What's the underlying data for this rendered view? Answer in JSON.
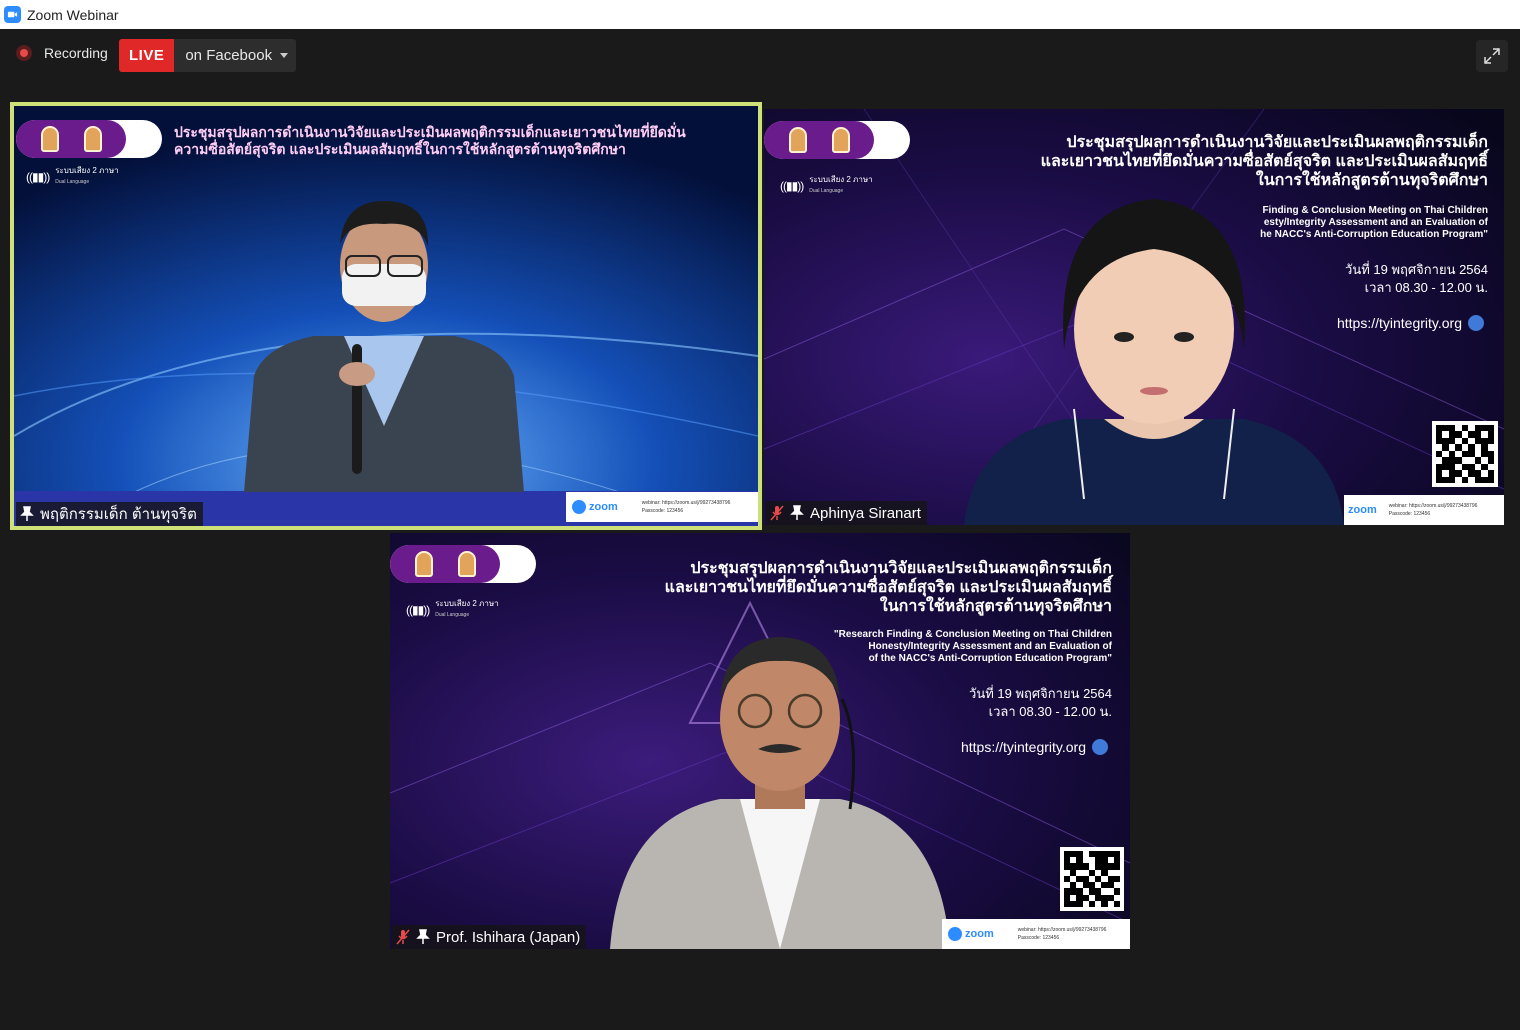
{
  "window": {
    "title": "Zoom Webinar"
  },
  "toolbar": {
    "recording_label": "Recording",
    "live_badge": "LIVE",
    "live_target": "on Facebook"
  },
  "tiles": [
    {
      "name": "พฤติกรรมเด็ก ต้านทุจริต",
      "muted": false,
      "active_speaker": true,
      "heading_th": [
        "ประชุมสรุปผลการดำเนินงานวิจัยและประเมินผลพฤติกรรมเด็กและเยาวชนไทยที่ยึดมั่น",
        "ความซื่อสัตย์สุจริต และประเมินผลสัมฤทธิ์ในการใช้หลักสูตรต้านทุจริตศึกษา"
      ],
      "dual_language": "ระบบเสียง 2 ภาษา",
      "dual_language_en": "Dual Language",
      "zoom_text": "zoom",
      "zoom_info": [
        "webinar: https://zoom.us/j/99273438796",
        "Passcode: 123456"
      ]
    },
    {
      "name": "Aphinya Siranart",
      "muted": true,
      "active_speaker": false,
      "heading_th": [
        "ประชุมสรุปผลการดำเนินงานวิจัยและประเมินผลพฤติกรรมเด็ก",
        "และเยาวชนไทยที่ยึดมั่นความซื่อสัตย์สุจริต และประเมินผลสัมฤทธิ์",
        "ในการใช้หลักสูตรต้านทุจริตศึกษา"
      ],
      "heading_en": [
        "Finding & Conclusion Meeting on Thai Children",
        "esty/Integrity Assessment and an Evaluation of",
        "he NACC's Anti-Corruption Education Program\""
      ],
      "date": "วันที่ 19 พฤศจิกายน 2564",
      "time": "เวลา 08.30 - 12.00 น.",
      "url": "https://tyintegrity.org",
      "dual_language": "ระบบเสียง 2 ภาษา",
      "dual_language_en": "Dual Language",
      "zoom_text": "zoom",
      "zoom_info": [
        "webinar: https://zoom.us/j/99273438796",
        "Passcode: 123456"
      ]
    },
    {
      "name": "Prof. Ishihara (Japan)",
      "muted": true,
      "active_speaker": false,
      "heading_th": [
        "ประชุมสรุปผลการดำเนินงานวิจัยและประเมินผลพฤติกรรมเด็ก",
        "และเยาวชนไทยที่ยึดมั่นความซื่อสัตย์สุจริต และประเมินผลสัมฤทธิ์",
        "ในการใช้หลักสูตรต้านทุจริตศึกษา"
      ],
      "heading_en": [
        "\"Research Finding & Conclusion Meeting on Thai Children",
        "Honesty/Integrity Assessment and an Evaluation of",
        "of the NACC's Anti-Corruption Education Program\""
      ],
      "date": "วันที่ 19 พฤศจิกายน 2564",
      "time": "เวลา 08.30 - 12.00 น.",
      "url": "https://tyintegrity.org",
      "dual_language": "ระบบเสียง 2 ภาษา",
      "dual_language_en": "Dual Language",
      "zoom_text": "zoom",
      "zoom_info": [
        "webinar: https://zoom.us/j/99273438796",
        "Passcode: 123456"
      ]
    }
  ],
  "colors": {
    "accent_live": "#e02828",
    "active_border": "#cde07a",
    "banner_purple": "#6b1c8c",
    "zoom_blue": "#2d8cff"
  }
}
